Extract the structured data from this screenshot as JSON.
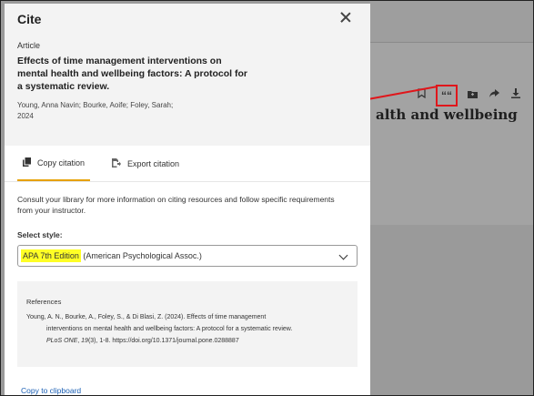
{
  "panel": {
    "title": "Cite",
    "article_type": "Article",
    "article_title": "Effects of time management interventions on mental health and wellbeing factors: A protocol for a systematic review.",
    "authors": "Young, Anna Navin; Bourke, Aoife; Foley, Sarah;",
    "year": "2024"
  },
  "tabs": [
    {
      "label": "Copy citation",
      "active": true,
      "icon": "copy-icon"
    },
    {
      "label": "Export citation",
      "active": false,
      "icon": "export-icon"
    }
  ],
  "intro": "Consult your library for more information on citing resources and follow specific requirements from your instructor.",
  "style_select": {
    "label": "Select style:",
    "highlight": "APA 7th Edition",
    "rest": " (American Psychological Assoc.)"
  },
  "reference": {
    "heading": "References",
    "line1": "Young, A. N., Bourke, A., Foley, S., & Di Blasi, Z. (2024). Effects of time management",
    "line2": "interventions on mental health and wellbeing factors: A protocol for a systematic review.",
    "journal": "PLoS ONE",
    "volume": "19",
    "rest": "(3), 1-8. https://doi.org/10.1371/journal.pone.0288887"
  },
  "copy_link": "Copy to clipboard",
  "background": {
    "title_fragment": "alth and wellbeing",
    "tools": [
      "bookmark-icon",
      "quote-icon",
      "folder-icon",
      "share-icon",
      "download-icon"
    ]
  },
  "colors": {
    "highlight": "#ffff26",
    "annotation_red": "#e0161b",
    "tab_accent": "#e6a100",
    "link": "#1a5fb4"
  }
}
